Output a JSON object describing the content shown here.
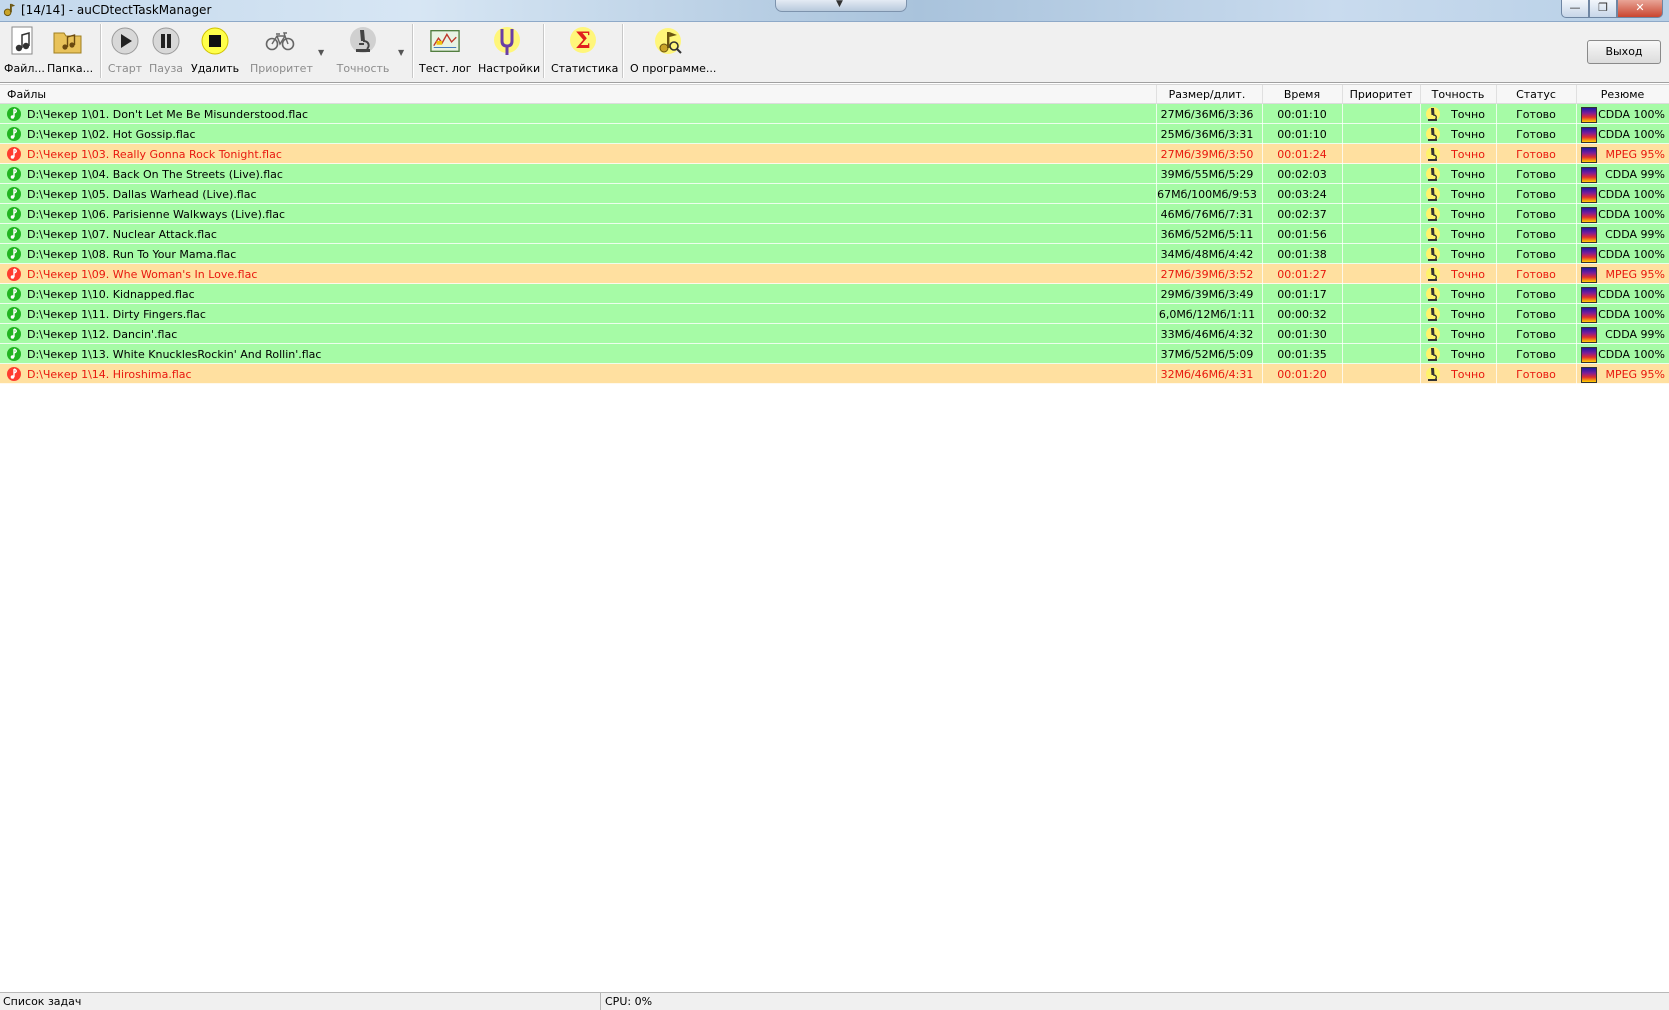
{
  "window": {
    "title": "[14/14] - auCDtectTaskManager",
    "min_symbol": "—",
    "max_symbol": "❐",
    "close_symbol": "✕"
  },
  "toolbar": {
    "files": "Файл...",
    "folder": "Папка...",
    "start": "Старт",
    "pause": "Пауза",
    "delete": "Удалить",
    "priority": "Приоритет",
    "accuracy": "Точность",
    "test_log": "Тест. лог",
    "settings": "Настройки",
    "statistics": "Статистика",
    "about": "О программе...",
    "exit": "Выход"
  },
  "columns": {
    "files": "Файлы",
    "size": "Размер/длит.",
    "time": "Время",
    "priority": "Приоритет",
    "accuracy": "Точность",
    "status": "Статус",
    "summary": "Резюме"
  },
  "rows": [
    {
      "file": "D:\\Чекер 1\\01. Don't Let Me Be Misunderstood.flac",
      "size": "27Мб/36Мб/3:36",
      "time": "00:01:10",
      "priority": "",
      "accuracy": "Точно",
      "status": "Готово",
      "summary": "CDDA 100%",
      "state": "ok"
    },
    {
      "file": "D:\\Чекер 1\\02. Hot Gossip.flac",
      "size": "25Мб/36Мб/3:31",
      "time": "00:01:10",
      "priority": "",
      "accuracy": "Точно",
      "status": "Готово",
      "summary": "CDDA 100%",
      "state": "ok"
    },
    {
      "file": "D:\\Чекер 1\\03. Really Gonna Rock Tonight.flac",
      "size": "27Мб/39Мб/3:50",
      "time": "00:01:24",
      "priority": "",
      "accuracy": "Точно",
      "status": "Готово",
      "summary": "MPEG 95%",
      "state": "warn"
    },
    {
      "file": "D:\\Чекер 1\\04. Back On The Streets (Live).flac",
      "size": "39Мб/55Мб/5:29",
      "time": "00:02:03",
      "priority": "",
      "accuracy": "Точно",
      "status": "Готово",
      "summary": "CDDA 99%",
      "state": "ok"
    },
    {
      "file": "D:\\Чекер 1\\05. Dallas Warhead (Live).flac",
      "size": "67Мб/100Мб/9:53",
      "time": "00:03:24",
      "priority": "",
      "accuracy": "Точно",
      "status": "Готово",
      "summary": "CDDA 100%",
      "state": "ok"
    },
    {
      "file": "D:\\Чекер 1\\06. Parisienne Walkways (Live).flac",
      "size": "46Мб/76Мб/7:31",
      "time": "00:02:37",
      "priority": "",
      "accuracy": "Точно",
      "status": "Готово",
      "summary": "CDDA 100%",
      "state": "ok"
    },
    {
      "file": "D:\\Чекер 1\\07. Nuclear Attack.flac",
      "size": "36Мб/52Мб/5:11",
      "time": "00:01:56",
      "priority": "",
      "accuracy": "Точно",
      "status": "Готово",
      "summary": "CDDA 99%",
      "state": "ok"
    },
    {
      "file": "D:\\Чекер 1\\08. Run To Your Mama.flac",
      "size": "34Мб/48Мб/4:42",
      "time": "00:01:38",
      "priority": "",
      "accuracy": "Точно",
      "status": "Готово",
      "summary": "CDDA 100%",
      "state": "ok"
    },
    {
      "file": "D:\\Чекер 1\\09. Whe Woman's In Love.flac",
      "size": "27Мб/39Мб/3:52",
      "time": "00:01:27",
      "priority": "",
      "accuracy": "Точно",
      "status": "Готово",
      "summary": "MPEG 95%",
      "state": "warn"
    },
    {
      "file": "D:\\Чекер 1\\10. Kidnapped.flac",
      "size": "29Мб/39Мб/3:49",
      "time": "00:01:17",
      "priority": "",
      "accuracy": "Точно",
      "status": "Готово",
      "summary": "CDDA 100%",
      "state": "ok"
    },
    {
      "file": "D:\\Чекер 1\\11. Dirty Fingers.flac",
      "size": "6,0Мб/12Мб/1:11",
      "time": "00:00:32",
      "priority": "",
      "accuracy": "Точно",
      "status": "Готово",
      "summary": "CDDA 100%",
      "state": "ok"
    },
    {
      "file": "D:\\Чекер 1\\12. Dancin'.flac",
      "size": "33Мб/46Мб/4:32",
      "time": "00:01:30",
      "priority": "",
      "accuracy": "Точно",
      "status": "Готово",
      "summary": "CDDA 99%",
      "state": "ok"
    },
    {
      "file": "D:\\Чекер 1\\13. White KnucklesRockin' And Rollin'.flac",
      "size": "37Мб/52Мб/5:09",
      "time": "00:01:35",
      "priority": "",
      "accuracy": "Точно",
      "status": "Готово",
      "summary": "CDDA 100%",
      "state": "ok"
    },
    {
      "file": "D:\\Чекер 1\\14. Hiroshima.flac",
      "size": "32Мб/46Мб/4:31",
      "time": "00:01:20",
      "priority": "",
      "accuracy": "Точно",
      "status": "Готово",
      "summary": "MPEG 95%",
      "state": "warn"
    }
  ],
  "statusbar": {
    "left": "Список задач",
    "cpu": "CPU: 0%"
  },
  "colors": {
    "row_ok": "#a6fba6",
    "row_warn": "#ffe0a0",
    "warn_text": "#e8170f"
  }
}
